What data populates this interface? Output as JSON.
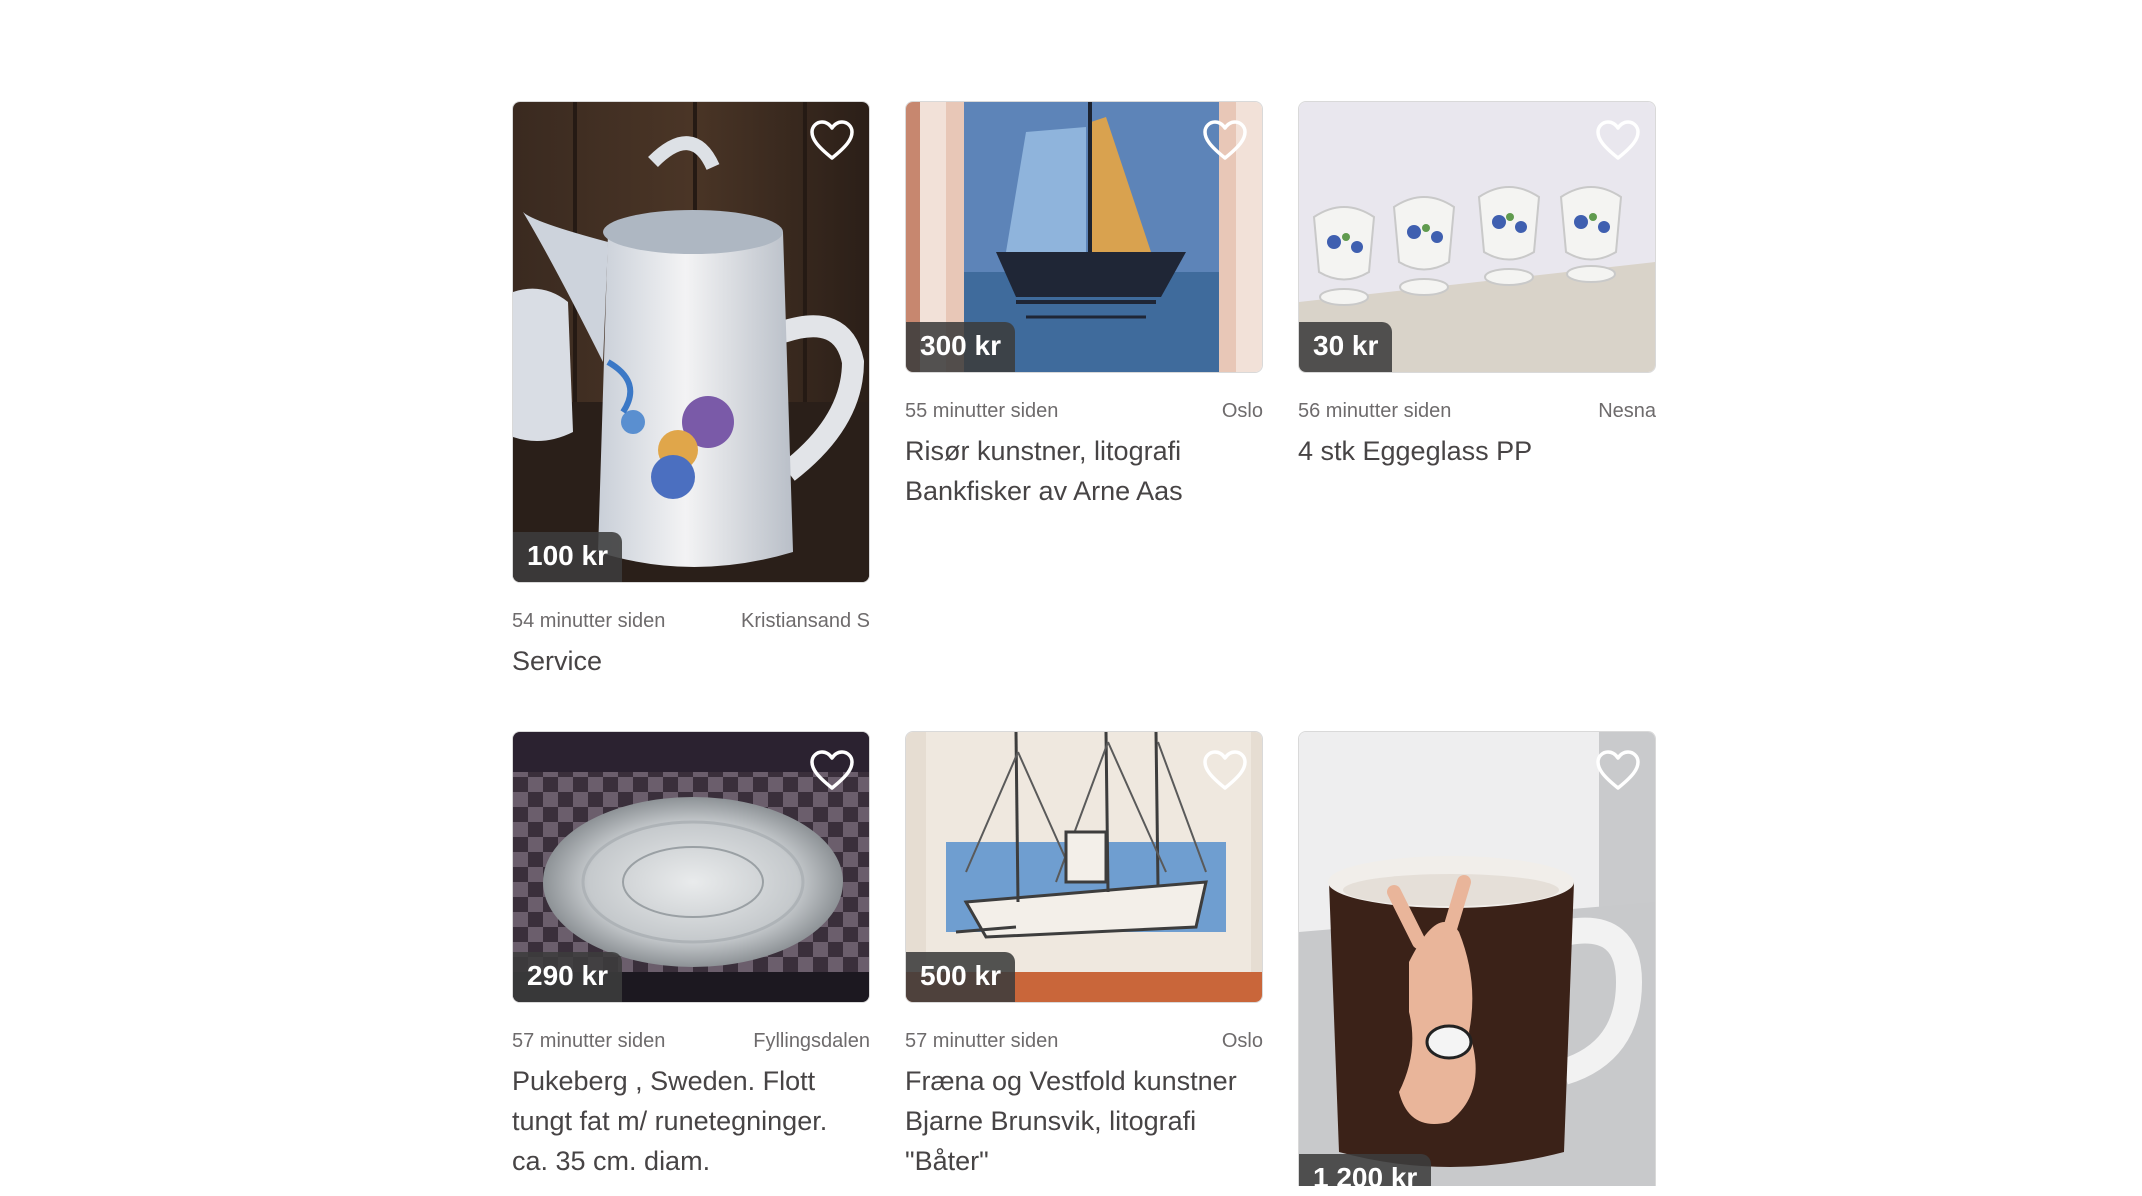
{
  "listings": [
    {
      "price": "100 kr",
      "time": "54 minutter siden",
      "location": "Kristiansand S",
      "title": "Service",
      "favorite_icon": "heart-outline-icon"
    },
    {
      "price": "300 kr",
      "time": "55 minutter siden",
      "location": "Oslo",
      "title": "Risør kunstner, litografi Bankfisker av Arne Aas",
      "favorite_icon": "heart-outline-icon"
    },
    {
      "price": "30 kr",
      "time": "56 minutter siden",
      "location": "Nesna",
      "title": "4 stk Eggeglass PP",
      "favorite_icon": "heart-outline-icon"
    },
    {
      "price": "290 kr",
      "time": "57 minutter siden",
      "location": "Fyllingsdalen",
      "title": "Pukeberg , Sweden. Flott tungt fat m/ runetegninger. ca. 35 cm. diam.",
      "favorite_icon": "heart-outline-icon"
    },
    {
      "price": "500 kr",
      "time": "57 minutter siden",
      "location": "Oslo",
      "title": "Fræna og Vestfold kunstner Bjarne Brunsvik, litografi \"Båter\"",
      "favorite_icon": "heart-outline-icon"
    },
    {
      "price": "1 200 kr",
      "favorite_icon": "heart-outline-icon"
    }
  ]
}
